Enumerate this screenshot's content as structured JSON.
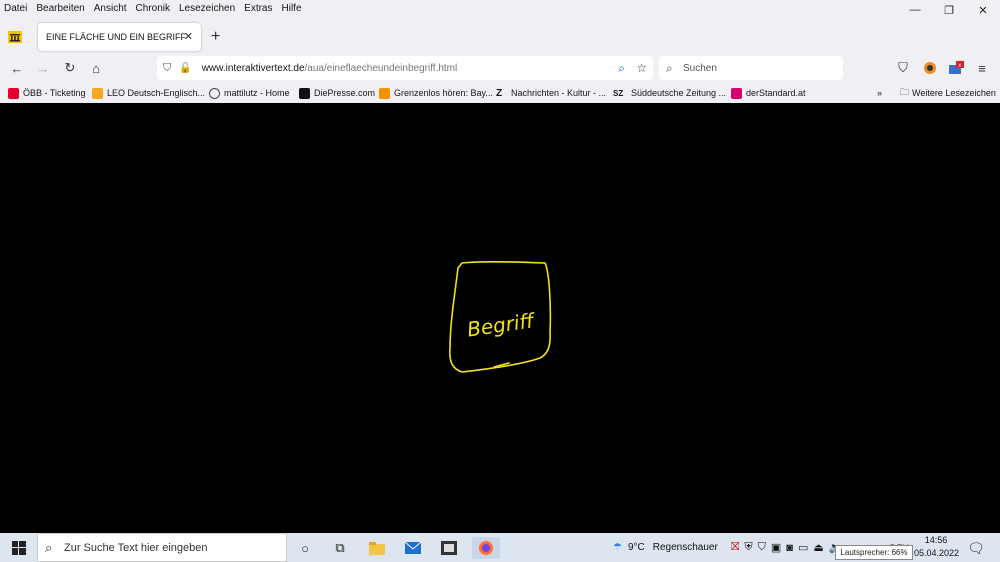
{
  "menu": [
    "Datei",
    "Bearbeiten",
    "Ansicht",
    "Chronik",
    "Lesezeichen",
    "Extras",
    "Hilfe"
  ],
  "tab": {
    "title": "EINE FLÄCHE UND EIN BEGRIFF"
  },
  "url": {
    "host": "www.interaktivertext.de",
    "path": "/aua/eineflaecheundeinbegriff.html"
  },
  "search": {
    "placeholder": "Suchen"
  },
  "bookmarks": [
    {
      "label": "ÖBB - Ticketing",
      "color": "#e2002a"
    },
    {
      "label": "LEO Deutsch-Englisch...",
      "color": "#f5a623"
    },
    {
      "label": "mattilutz - Home",
      "color": "#444444"
    },
    {
      "label": "DiePresse.com",
      "color": "#111111"
    },
    {
      "label": "Grenzenlos hören: Bay...",
      "color": "#f29400"
    },
    {
      "label": "Nachrichten - Kultur - ...",
      "color": "#222222"
    },
    {
      "label": "Süddeutsche Zeitung ...",
      "color": "#222222"
    },
    {
      "label": "derStandard.at",
      "color": "#d6006f"
    }
  ],
  "bookmarks_more": "Weitere Lesezeichen",
  "drawing": {
    "word": "Begriff",
    "stroke_color": "#f2e21a"
  },
  "taskbar": {
    "search_placeholder": "Zur Suche Text hier eingeben",
    "weather_temp": "9°C",
    "weather_text": "Regenschauer",
    "lang": "DEU",
    "time": "14:56",
    "date": "05.04.2022",
    "tooltip": "Lautsprecher: 66%"
  }
}
